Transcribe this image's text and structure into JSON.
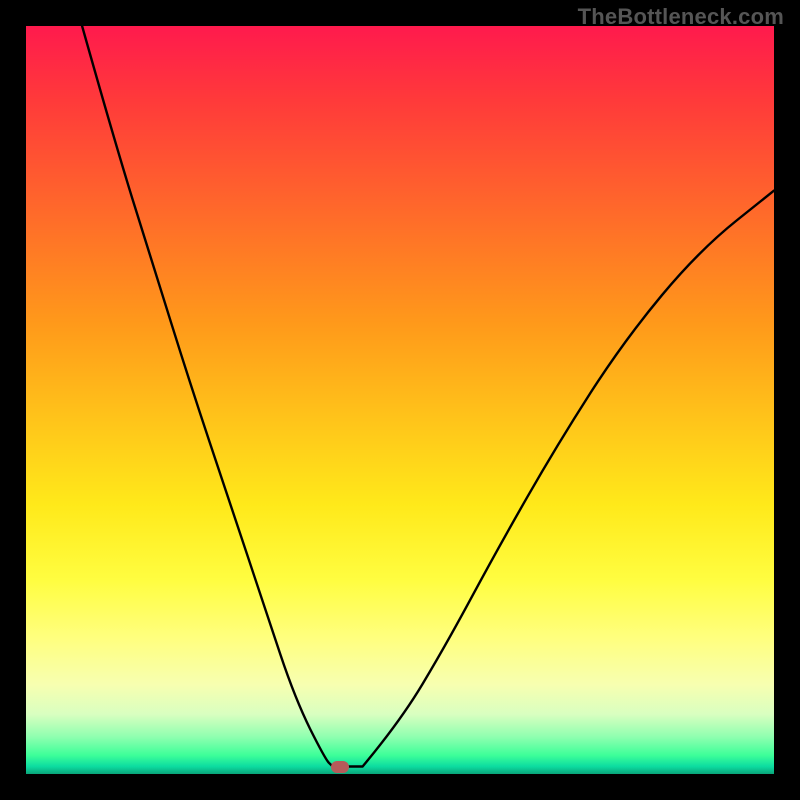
{
  "watermark": "TheBottleneck.com",
  "colors": {
    "page_bg": "#000000",
    "watermark": "#555555",
    "curve": "#000000",
    "marker": "#b65a5a",
    "gradient_top": "#ff1a4d",
    "gradient_bottom": "#0aa47a"
  },
  "marker": {
    "u": 0.42,
    "v": 0.99
  },
  "chart_data": {
    "type": "line",
    "title": "",
    "xlabel": "",
    "ylabel": "",
    "xlim": [
      0,
      1
    ],
    "ylim": [
      0,
      1
    ],
    "series": [
      {
        "name": "left-branch",
        "x": [
          0.075,
          0.12,
          0.17,
          0.22,
          0.27,
          0.32,
          0.36,
          0.4,
          0.41
        ],
        "y": [
          1.0,
          0.84,
          0.68,
          0.52,
          0.37,
          0.22,
          0.1,
          0.02,
          0.01
        ]
      },
      {
        "name": "floor",
        "x": [
          0.41,
          0.45
        ],
        "y": [
          0.01,
          0.01
        ]
      },
      {
        "name": "right-branch",
        "x": [
          0.45,
          0.5,
          0.56,
          0.63,
          0.71,
          0.8,
          0.9,
          1.0
        ],
        "y": [
          0.01,
          0.07,
          0.17,
          0.3,
          0.44,
          0.58,
          0.7,
          0.78
        ]
      }
    ],
    "annotations": [
      {
        "name": "min-marker",
        "x": 0.42,
        "y": 0.01
      }
    ]
  }
}
